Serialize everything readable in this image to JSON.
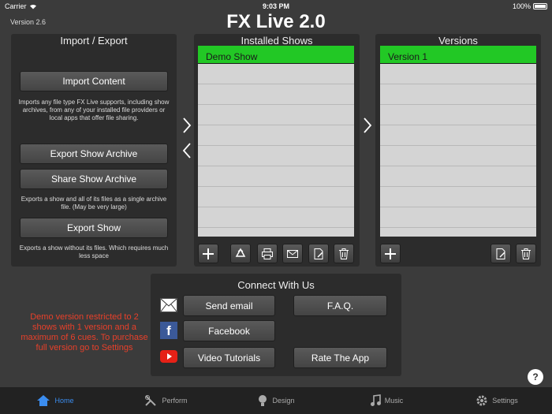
{
  "status_bar": {
    "carrier": "Carrier",
    "time": "9:03 PM",
    "battery": "100%"
  },
  "app": {
    "version": "Version 2.6",
    "title": "FX Live 2.0"
  },
  "import_export": {
    "title": "Import / Export",
    "import_content_label": "Import Content",
    "import_desc": "Imports any file type FX Live supports, including show archives, from any of your installed file providers or local apps that offer file sharing.",
    "export_archive_label": "Export Show Archive",
    "share_archive_label": "Share Show Archive",
    "archive_desc": "Exports a show and all of its files as a single archive file.  (May be very large)",
    "export_show_label": "Export Show",
    "export_show_desc": "Exports a show without its files. Which requires much less space"
  },
  "installed_shows": {
    "title": "Installed Shows",
    "items": [
      "Demo Show"
    ]
  },
  "versions": {
    "title": "Versions",
    "items": [
      "Version 1"
    ]
  },
  "connect": {
    "title": "Connect With Us",
    "send_email_label": "Send email",
    "faq_label": "F.A.Q.",
    "facebook_label": "Facebook",
    "video_tutorials_label": "Video Tutorials",
    "rate_app_label": "Rate The App"
  },
  "demo_notice": "Demo version restricted to 2 shows with 1 version and a maximum of 6 cues. To purchase full version go to Settings",
  "help_label": "?",
  "tabs": {
    "home": "Home",
    "perform": "Perform",
    "design": "Design",
    "music": "Music",
    "settings": "Settings"
  },
  "colors": {
    "accent_green": "#22c825",
    "tab_active": "#3b8df0",
    "demo_text": "#e8402a"
  }
}
